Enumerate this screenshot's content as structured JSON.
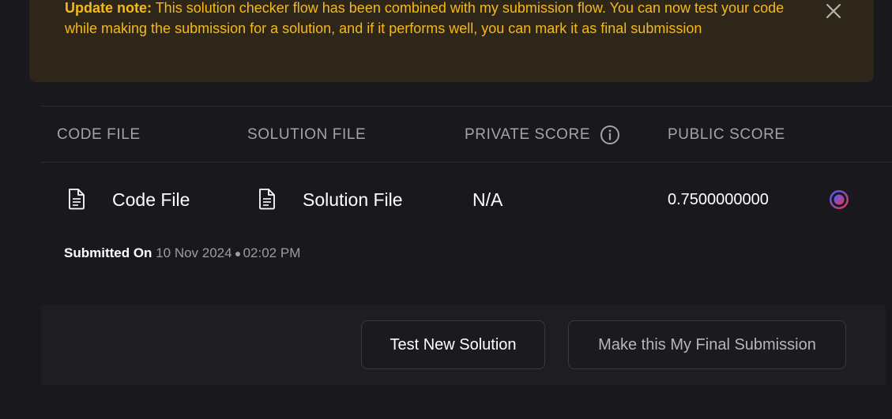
{
  "banner": {
    "label": "Update note:",
    "message": "This solution checker flow has been combined with my submission flow. You can now test your code while making the submission for a solution, and if it performs well, you can mark it as final submission",
    "close_icon": "close-icon",
    "text_color": "#f5b91b",
    "background": "#2e2719"
  },
  "table": {
    "headers": {
      "code_file": "CODE FILE",
      "solution_file": "SOLUTION FILE",
      "private_score": "PRIVATE SCORE",
      "public_score": "PUBLIC SCORE"
    },
    "row": {
      "code_file": "Code File",
      "solution_file": "Solution File",
      "private_score": "N/A",
      "public_score": "0.7500000000",
      "submitted_label": "Submitted On",
      "submitted_date": "10 Nov 2024",
      "submitted_time": "02:02 PM"
    }
  },
  "footer": {
    "test_button": "Test New Solution",
    "final_button": "Make this My Final Submission"
  }
}
